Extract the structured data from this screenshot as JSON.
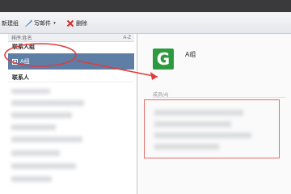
{
  "toolbar": {
    "new_group_label": "新建组",
    "send_mail_label": "写邮件",
    "send_mail_caret": "▼",
    "delete_label": "删除"
  },
  "left_pane": {
    "sort_label": "排序:姓名",
    "sort_range": "A-Z",
    "group_header": "联系人组",
    "selected_group": "A组",
    "contacts_header": "联系人"
  },
  "right_pane": {
    "logo_letter": "G",
    "contact_name": "A组",
    "members_label": "成员(4)"
  },
  "colors": {
    "selection": "#5f7ea6",
    "logo": "#2e9a3f",
    "annotation": "#e03c3c"
  }
}
